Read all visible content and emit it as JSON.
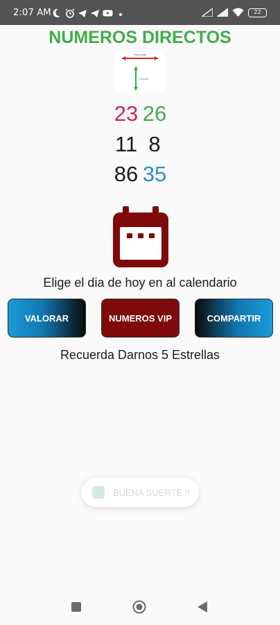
{
  "status_bar": {
    "time": "2:07 AM",
    "battery": "22"
  },
  "header": {
    "title": "NUMEROS DIRECTOS",
    "axis_horizontal_label": "Horizontal",
    "axis_vertical_label": "Vertical"
  },
  "numbers": {
    "rows": [
      {
        "left": "23",
        "right": "26",
        "left_color": "#d2215a",
        "right_color": "#4aa94a"
      },
      {
        "left": "11",
        "right": "8",
        "left_color": "#1a1a1a",
        "right_color": "#1a1a1a"
      },
      {
        "left": "86",
        "right": "35",
        "left_color": "#1a1a1a",
        "right_color": "#2a91c8"
      }
    ]
  },
  "calendar": {
    "icon": "calendar-icon",
    "instruction": "Elige el dia de hoy en al calendario"
  },
  "buttons": {
    "valorar": "VALORAR",
    "vip": "NUMEROS VIP",
    "compartir": "COMPARTIR"
  },
  "reminder": "Recuerda Darnos 5 Estrellas",
  "toast": {
    "text": "BUENA SUERTE !!"
  },
  "colors": {
    "title": "#3fae49",
    "calendar": "#7f0a0a",
    "vip_button": "#7f0a0a",
    "blue_button": "#1a9bd8",
    "status_bar": "#545454"
  }
}
